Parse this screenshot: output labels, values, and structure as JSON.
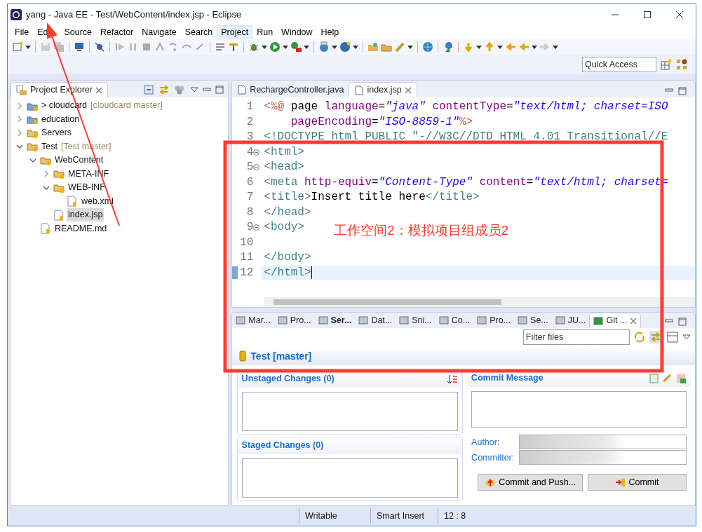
{
  "window": {
    "title": "yang - Java EE - Test/WebContent/index.jsp - Eclipse"
  },
  "menu": [
    {
      "label": "File",
      "selected": false
    },
    {
      "label": "Ed",
      "selected": false
    },
    {
      "label": "Source",
      "selected": false
    },
    {
      "label": "Refactor",
      "selected": false
    },
    {
      "label": "Navigate",
      "selected": false
    },
    {
      "label": "Search",
      "selected": false
    },
    {
      "label": "Project",
      "selected": true
    },
    {
      "label": "Run",
      "selected": false
    },
    {
      "label": "Window",
      "selected": false
    },
    {
      "label": "Help",
      "selected": false
    }
  ],
  "quick_access": {
    "placeholder": "Quick Access"
  },
  "project_explorer": {
    "title": "Project Explorer",
    "tree": [
      {
        "label": "> cloudcard",
        "decoration": "[cloudcard master]",
        "expanded": false,
        "selected": false
      },
      {
        "label": "education",
        "expanded": false,
        "selected": false
      },
      {
        "label": "Servers",
        "expanded": false,
        "selected": false
      },
      {
        "label": "Test",
        "decoration": "[Test master]",
        "expanded": true,
        "selected": false,
        "children": [
          {
            "label": "WebContent",
            "expanded": true,
            "selected": false,
            "children": [
              {
                "label": "META-INF",
                "expanded": false,
                "selected": false
              },
              {
                "label": "WEB-INF",
                "expanded": true,
                "selected": false,
                "children": [
                  {
                    "label": "web.xml",
                    "selected": false
                  }
                ]
              },
              {
                "label": "index.jsp",
                "selected": true
              }
            ]
          },
          {
            "label": "README.md",
            "selected": false
          }
        ]
      }
    ]
  },
  "editor": {
    "tabs": [
      {
        "label": "RechargeController.java",
        "selected": false
      },
      {
        "label": "index.jsp",
        "selected": true
      }
    ],
    "lines": [
      {
        "number": "1",
        "foldable": false,
        "current": false,
        "tokens": [
          {
            "kind": "directive",
            "text": "<%@"
          },
          {
            "kind": "plain",
            "text": " page "
          },
          {
            "kind": "attr",
            "text": "language"
          },
          {
            "kind": "plain",
            "text": "="
          },
          {
            "kind": "string",
            "text": "\"java\""
          },
          {
            "kind": "attr",
            "text": " contentType"
          },
          {
            "kind": "plain",
            "text": "="
          },
          {
            "kind": "string",
            "text": "\"text/html; charset=ISO"
          }
        ]
      },
      {
        "number": "2",
        "foldable": false,
        "current": false,
        "tokens": [
          {
            "kind": "attr",
            "text": "    pageEncoding"
          },
          {
            "kind": "plain",
            "text": "="
          },
          {
            "kind": "string",
            "text": "\"ISO-8859-1\""
          },
          {
            "kind": "directive",
            "text": "%>"
          }
        ]
      },
      {
        "number": "3",
        "foldable": false,
        "current": false,
        "tokens": [
          {
            "kind": "doctype",
            "text": "<!DOCTYPE html PUBLIC \"-//W3C//DTD HTML 4.01 Transitional//E"
          }
        ]
      },
      {
        "number": "4",
        "foldable": true,
        "current": false,
        "tokens": [
          {
            "kind": "tag",
            "text": "<html>"
          }
        ]
      },
      {
        "number": "5",
        "foldable": true,
        "current": false,
        "tokens": [
          {
            "kind": "tag",
            "text": "<head>"
          }
        ]
      },
      {
        "number": "6",
        "foldable": false,
        "current": false,
        "tokens": [
          {
            "kind": "tag",
            "text": "<meta"
          },
          {
            "kind": "attr",
            "text": " http-equiv"
          },
          {
            "kind": "plain",
            "text": "="
          },
          {
            "kind": "string",
            "text": "\"Content-Type\""
          },
          {
            "kind": "attr",
            "text": " content"
          },
          {
            "kind": "plain",
            "text": "="
          },
          {
            "kind": "string",
            "text": "\"text/html; charset="
          }
        ]
      },
      {
        "number": "7",
        "foldable": false,
        "current": false,
        "tokens": [
          {
            "kind": "tag",
            "text": "<title>"
          },
          {
            "kind": "plain",
            "text": "Insert title here"
          },
          {
            "kind": "tag",
            "text": "</title>"
          }
        ]
      },
      {
        "number": "8",
        "foldable": false,
        "current": false,
        "tokens": [
          {
            "kind": "tag",
            "text": "</head>"
          }
        ]
      },
      {
        "number": "9",
        "foldable": true,
        "current": false,
        "tokens": [
          {
            "kind": "tag",
            "text": "<body>"
          }
        ]
      },
      {
        "number": "10",
        "foldable": false,
        "current": false
      },
      {
        "number": "11",
        "foldable": false,
        "current": false,
        "tokens": [
          {
            "kind": "tag",
            "text": "</body>"
          }
        ]
      },
      {
        "number": "12",
        "foldable": false,
        "current": true,
        "tokens": [
          {
            "kind": "tag",
            "text": "</html>"
          }
        ]
      }
    ]
  },
  "bottom_views": {
    "tabs": [
      {
        "label": "Mar...",
        "selected": false
      },
      {
        "label": "Pro...",
        "selected": false
      },
      {
        "label": "Ser...",
        "selected": false
      },
      {
        "label": "Dat...",
        "selected": false
      },
      {
        "label": "Sni...",
        "selected": false
      },
      {
        "label": "Co...",
        "selected": false
      },
      {
        "label": "Pro...",
        "selected": false
      },
      {
        "label": "Se...",
        "selected": false
      },
      {
        "label": "JU...",
        "selected": false
      },
      {
        "label": "Git ...",
        "selected": true
      }
    ],
    "filter": {
      "placeholder": "Filter files"
    },
    "repository": "Test [master]",
    "unstaged": "Unstaged Changes (0)",
    "staged": "Staged Changes (0)",
    "commit_message": "Commit Message",
    "author_label": "Author:",
    "committer_label": "Committer:",
    "buttons": [
      "Commit and Push...",
      "Commit"
    ]
  },
  "status_bar": [
    "Writable",
    "Smart Insert",
    "12 : 8"
  ],
  "annotation": {
    "text": "工作空间2：模拟项目组成员2"
  }
}
